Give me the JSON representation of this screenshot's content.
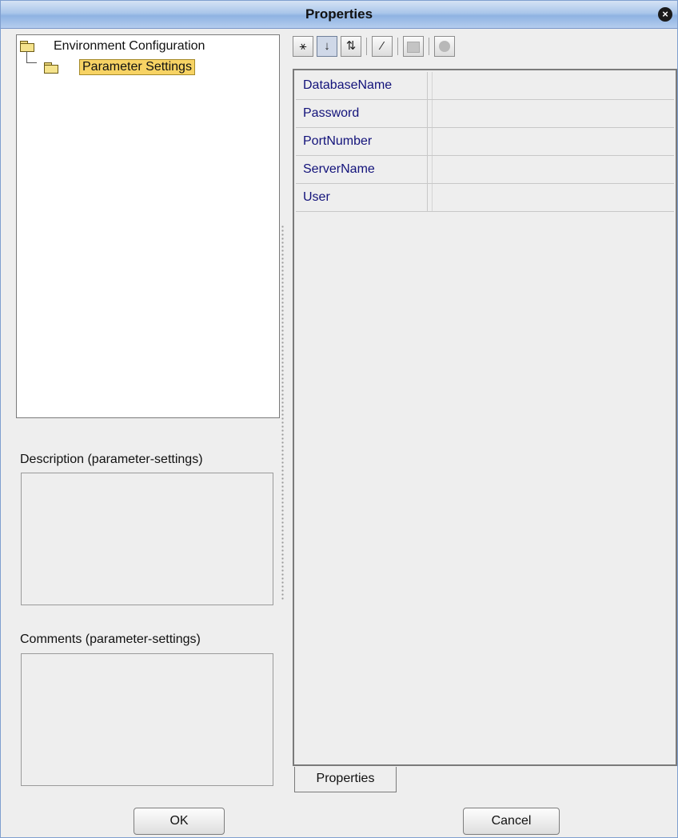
{
  "window": {
    "title": "Properties"
  },
  "tree": {
    "root_label": "Environment Configuration",
    "child_label": "Parameter Settings"
  },
  "description": {
    "label": "Description (parameter-settings)",
    "value": ""
  },
  "comments": {
    "label": "Comments (parameter-settings)",
    "value": ""
  },
  "toolbar": {
    "buttons": [
      {
        "name": "sort-categories-icon",
        "glyph": "⚹",
        "state": "normal"
      },
      {
        "name": "sort-alphabetical-icon",
        "glyph": "↓",
        "state": "pressed"
      },
      {
        "name": "sort-by-type-icon",
        "glyph": "⇅",
        "state": "normal"
      },
      {
        "name": "show-editable-icon",
        "glyph": "⁄",
        "state": "normal"
      },
      {
        "name": "property-sheet-icon",
        "glyph": "",
        "state": "disabled"
      },
      {
        "name": "help-icon",
        "glyph": "",
        "state": "disabled"
      }
    ]
  },
  "properties": {
    "rows": [
      {
        "name": "DatabaseName",
        "value": ""
      },
      {
        "name": "Password",
        "value": ""
      },
      {
        "name": "PortNumber",
        "value": ""
      },
      {
        "name": "ServerName",
        "value": ""
      },
      {
        "name": "User",
        "value": ""
      }
    ],
    "tab_label": "Properties"
  },
  "buttons": {
    "ok_label": "OK",
    "cancel_label": "Cancel"
  },
  "colors": {
    "title_bar": "#aac6ea",
    "selection": "#f7d364",
    "property_name": "#12127a"
  }
}
